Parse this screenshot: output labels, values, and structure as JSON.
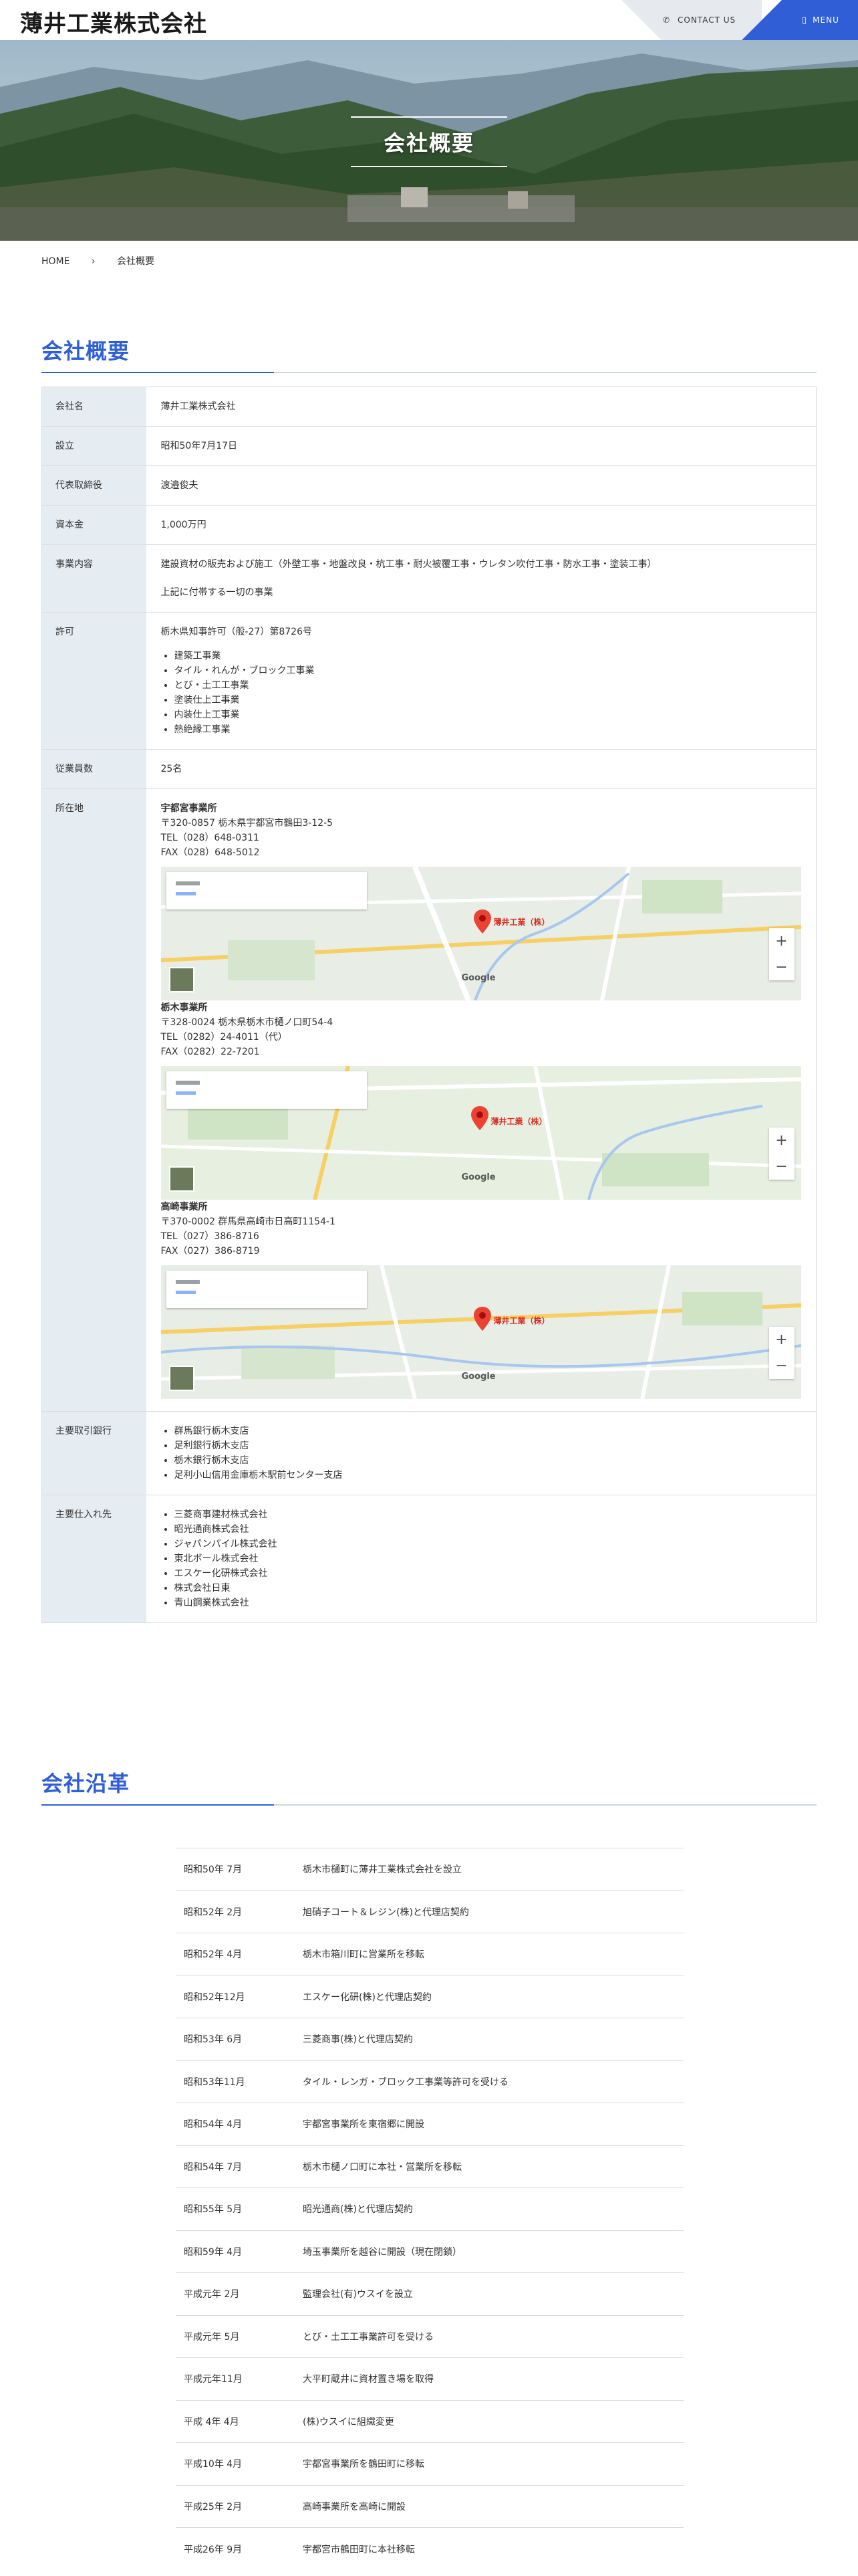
{
  "header": {
    "logo": "薄井工業株式会社",
    "contact_label": "CONTACT US",
    "menu_label": "MENU",
    "phone_icon": "phone-icon",
    "menu_icon": "menu-icon"
  },
  "hero": {
    "title": "会社概要"
  },
  "breadcrumb": {
    "home": "HOME",
    "separator": "›",
    "current": "会社概要"
  },
  "company": {
    "heading": "会社概要",
    "rows": {
      "name": {
        "label": "会社名",
        "value": "薄井工業株式会社"
      },
      "founded": {
        "label": "設立",
        "value": "昭和50年7月17日"
      },
      "ceo": {
        "label": "代表取締役",
        "value": "渡邉俊夫"
      },
      "capital": {
        "label": "資本金",
        "value": "1,000万円"
      },
      "business": {
        "label": "事業内容",
        "line1": "建設資材の販売および施工（外壁工事・地盤改良・杭工事・耐火被覆工事・ウレタン吹付工事・防水工事・塗装工事）",
        "line2": "上記に付帯する一切の事業"
      },
      "license": {
        "label": "許可",
        "value": "栃木県知事許可（般-27）第8726号",
        "items": [
          "建築工事業",
          "タイル・れんが・ブロック工事業",
          "とび・土工工事業",
          "塗装仕上工事業",
          "内装仕上工事業",
          "熱絶縁工事業"
        ]
      },
      "employees": {
        "label": "従業員数",
        "value": "25名"
      },
      "location": {
        "label": "所在地",
        "offices": [
          {
            "name": "宇都宮事業所",
            "address": "〒320-0857 栃木県宇都宮市鶴田3-12-5",
            "tel": "TEL（028）648-0311",
            "fax": "FAX（028）648-5012",
            "pin": "薄井工業（株）"
          },
          {
            "name": "栃木事業所",
            "address": "〒328-0024 栃木県栃木市樋ノ口町54-4",
            "tel": "TEL（0282）24-4011（代）",
            "fax": "FAX（0282）22-7201",
            "pin": "薄井工業（株）"
          },
          {
            "name": "高崎事業所",
            "address": "〒370-0002 群馬県高崎市日高町1154-1",
            "tel": "TEL（027）386-8716",
            "fax": "FAX（027）386-8719",
            "pin": "薄井工業（株）"
          }
        ],
        "map_zoom_in": "+",
        "map_zoom_out": "−",
        "map_brand": "Google"
      },
      "banks": {
        "label": "主要取引銀行",
        "items": [
          "群馬銀行栃木支店",
          "足利銀行栃木支店",
          "栃木銀行栃木支店",
          "足利小山信用金庫栃木駅前センター支店"
        ]
      },
      "suppliers": {
        "label": "主要仕入れ先",
        "items": [
          "三菱商事建材株式会社",
          "昭光通商株式会社",
          "ジャパンパイル株式会社",
          "東北ボール株式会社",
          "エスケー化研株式会社",
          "株式会社日東",
          "青山鋼業株式会社"
        ]
      }
    }
  },
  "history": {
    "heading": "会社沿革",
    "rows": [
      {
        "year": "昭和50年 7月",
        "event": "栃木市樋町に薄井工業株式会社を設立"
      },
      {
        "year": "昭和52年 2月",
        "event": "旭硝子コート＆レジン(株)と代理店契約"
      },
      {
        "year": "昭和52年 4月",
        "event": "栃木市箱川町に営業所を移転"
      },
      {
        "year": "昭和52年12月",
        "event": "エスケー化研(株)と代理店契約"
      },
      {
        "year": "昭和53年 6月",
        "event": "三菱商事(株)と代理店契約"
      },
      {
        "year": "昭和53年11月",
        "event": "タイル・レンガ・ブロック工事業等許可を受ける"
      },
      {
        "year": "昭和54年 4月",
        "event": "宇都宮事業所を東宿郷に開設"
      },
      {
        "year": "昭和54年 7月",
        "event": "栃木市樋ノ口町に本社・営業所を移転"
      },
      {
        "year": "昭和55年 5月",
        "event": "昭光通商(株)と代理店契約"
      },
      {
        "year": "昭和59年 4月",
        "event": "埼玉事業所を越谷に開設（現在閉鎖）"
      },
      {
        "year": "平成元年 2月",
        "event": "監理会社(有)ウスイを設立"
      },
      {
        "year": "平成元年 5月",
        "event": "とび・土工工事業許可を受ける"
      },
      {
        "year": "平成元年11月",
        "event": "大平町蔵井に資材置き場を取得"
      },
      {
        "year": "平成 4年 4月",
        "event": "(株)ウスイに組織変更"
      },
      {
        "year": "平成10年 4月",
        "event": "宇都宮事業所を鶴田町に移転"
      },
      {
        "year": "平成25年 2月",
        "event": "高崎事業所を高崎に開設"
      },
      {
        "year": "平成26年 9月",
        "event": "宇都宮市鶴田町に本社移転"
      }
    ]
  }
}
